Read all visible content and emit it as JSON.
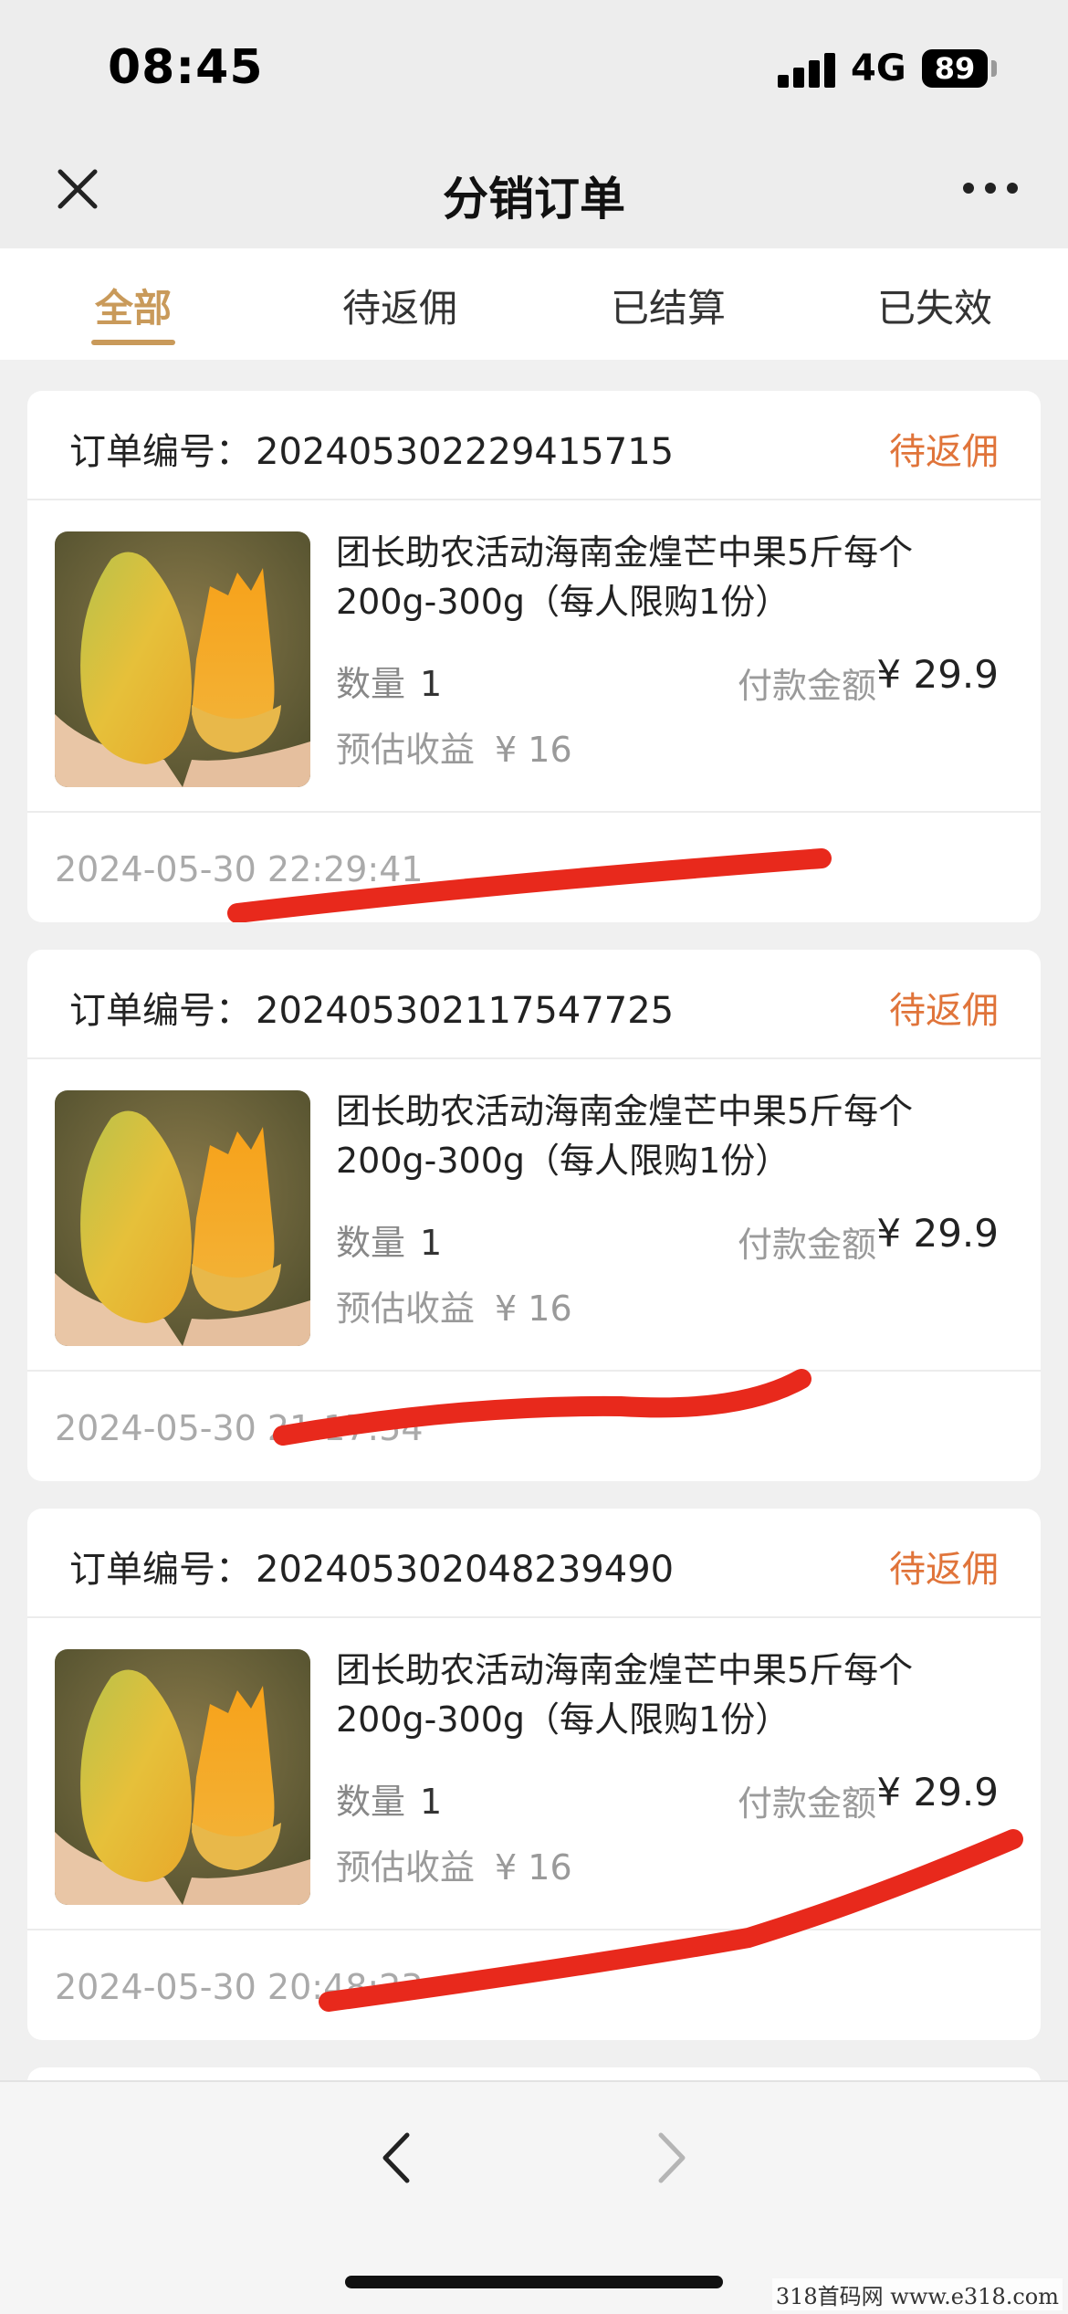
{
  "status_bar": {
    "time": "08:45",
    "network": "4G",
    "battery": "89"
  },
  "nav": {
    "title": "分销订单",
    "close_icon": "close-icon",
    "more_icon": "more-icon"
  },
  "tabs": [
    {
      "label": "全部",
      "active": true
    },
    {
      "label": "待返佣",
      "active": false
    },
    {
      "label": "已结算",
      "active": false
    },
    {
      "label": "已失效",
      "active": false
    }
  ],
  "labels": {
    "order_no": "订单编号：",
    "quantity": "数量",
    "pay_amount": "付款金额",
    "est_income": "预估收益"
  },
  "orders": [
    {
      "order_no": "20240530222941571​5",
      "status": "待返佣",
      "product_name": "团长助农活动海南金煌芒中果5斤每个200g-300g（每人限购1份）",
      "quantity": "1",
      "pay_amount": "¥ 29.9",
      "est_income": "¥ 16",
      "time": "2024-05-30 22:29:41"
    },
    {
      "order_no": "202405302117547725",
      "status": "待返佣",
      "product_name": "团长助农活动海南金煌芒中果5斤每个200g-300g（每人限购1份）",
      "quantity": "1",
      "pay_amount": "¥ 29.9",
      "est_income": "¥ 16",
      "time": "2024-05-30 21:17:54"
    },
    {
      "order_no": "202405302048239490",
      "status": "待返佣",
      "product_name": "团长助农活动海南金煌芒中果5斤每个200g-300g（每人限购1份）",
      "quantity": "1",
      "pay_amount": "¥ 29.9",
      "est_income": "¥ 16",
      "time": "2024-05-30 20:48:23"
    }
  ],
  "toolbar": {
    "back_icon": "chevron-left-icon",
    "forward_icon": "chevron-right-icon"
  },
  "watermark": "318首码网  www.e318.com",
  "colors": {
    "accent": "#c99a5a",
    "status": "#e0743a",
    "scribble": "#e8291c"
  }
}
